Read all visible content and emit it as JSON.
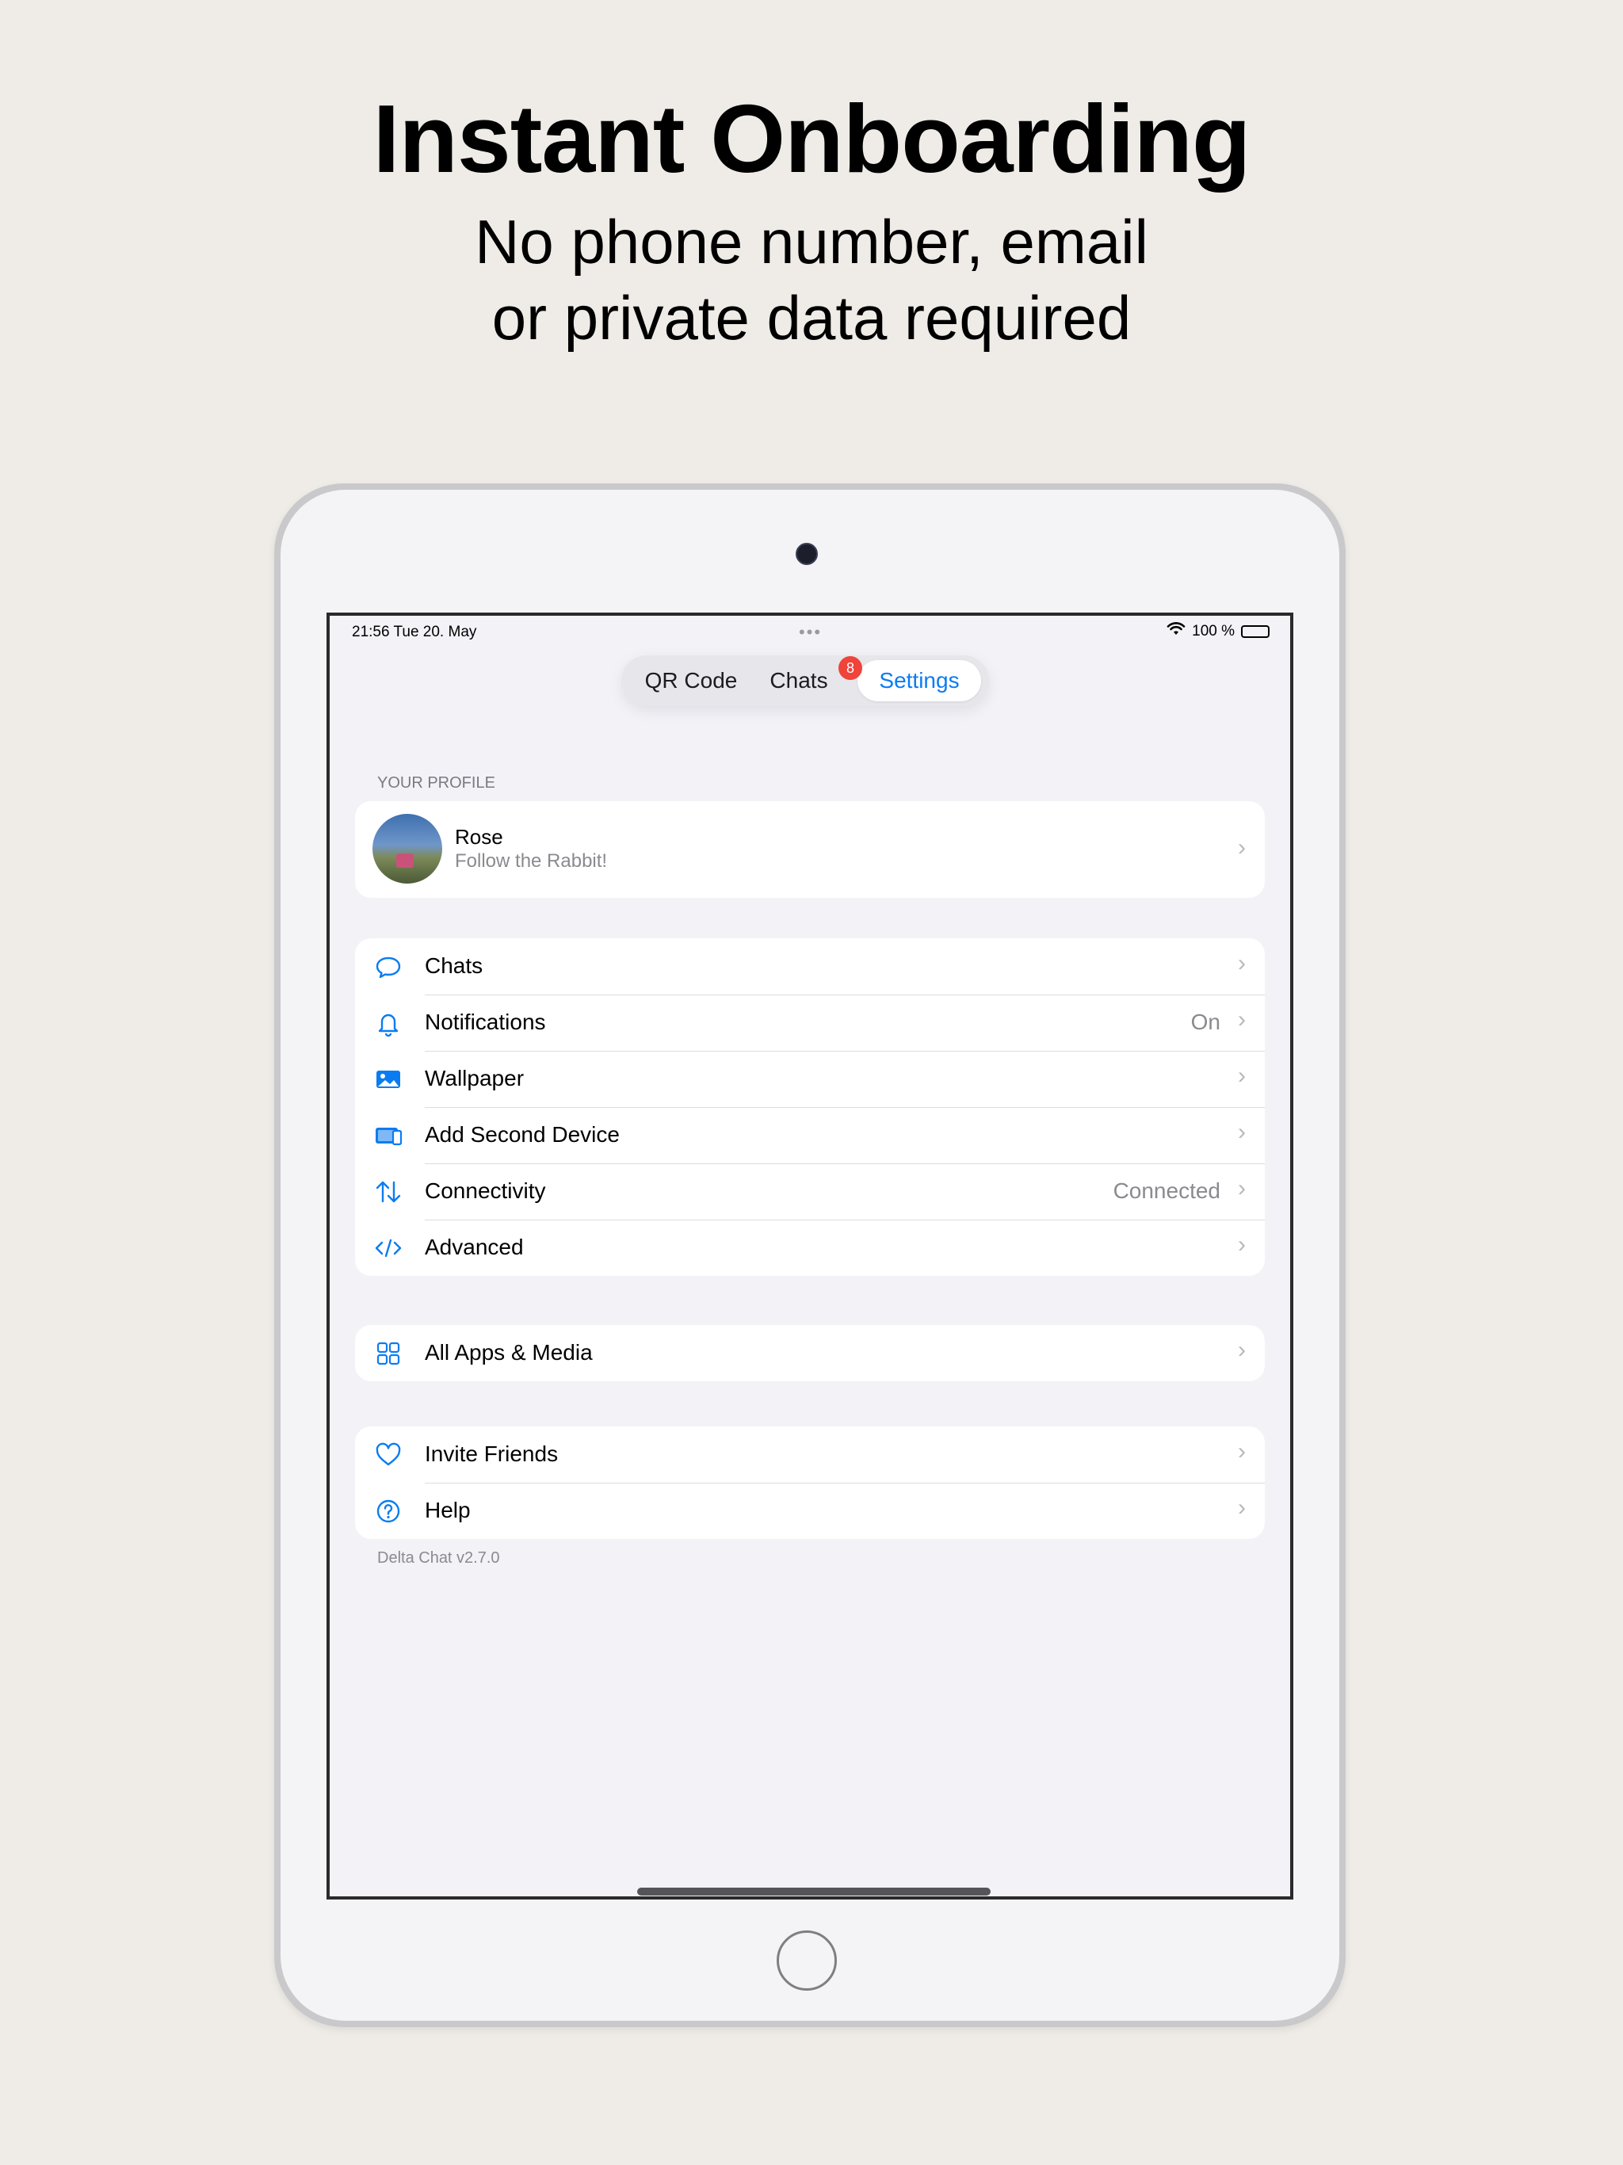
{
  "hero": {
    "title": "Instant Onboarding",
    "subtitle_line1": "No phone number, email",
    "subtitle_line2": "or private data required"
  },
  "status_bar": {
    "time_date": "21:56   Tue 20. May",
    "dots": "•••",
    "battery_text": "100 %"
  },
  "tabs": {
    "qr": "QR Code",
    "chats": "Chats",
    "chats_badge": "8",
    "settings": "Settings",
    "selected": "Settings"
  },
  "profile": {
    "section_header": "YOUR PROFILE",
    "name": "Rose",
    "status": "Follow the Rabbit!"
  },
  "settings_group1": [
    {
      "icon": "chat-bubble-icon",
      "label": "Chats",
      "value": ""
    },
    {
      "icon": "bell-icon",
      "label": "Notifications",
      "value": "On"
    },
    {
      "icon": "wallpaper-icon",
      "label": "Wallpaper",
      "value": ""
    },
    {
      "icon": "devices-icon",
      "label": "Add Second Device",
      "value": ""
    },
    {
      "icon": "arrows-updown-icon",
      "label": "Connectivity",
      "value": "Connected"
    },
    {
      "icon": "code-icon",
      "label": "Advanced",
      "value": ""
    }
  ],
  "settings_group2": [
    {
      "icon": "apps-grid-icon",
      "label": "All Apps & Media",
      "value": ""
    }
  ],
  "settings_group3": [
    {
      "icon": "heart-icon",
      "label": "Invite Friends",
      "value": ""
    },
    {
      "icon": "question-icon",
      "label": "Help",
      "value": ""
    }
  ],
  "footer": {
    "version": "Delta Chat v2.7.0"
  },
  "colors": {
    "accent": "#0a7cf2",
    "badge": "#f0433a",
    "background": "#efece7",
    "screen_bg": "#f2f2f7"
  }
}
